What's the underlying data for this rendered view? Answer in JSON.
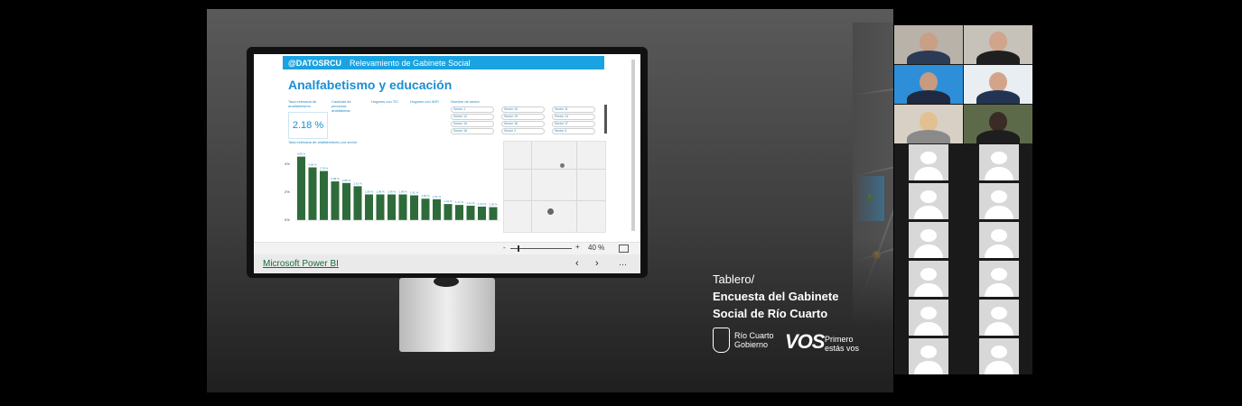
{
  "report": {
    "brand": "@DATOSRCU",
    "header_subtitle": "Relevamiento de Gabinete Social",
    "title": "Analfabetismo y educación",
    "kpi_labels": {
      "tasa": "Tasa estimada de analfabetismo",
      "cantidad": "Cantidad de personas analfabetas",
      "tic": "Hogares con TIC",
      "wifi": "Hogares con WiFi",
      "sector": "Nombre de sector"
    },
    "kpi_value": "2.18 %",
    "chart_label": "Tasa estimada de analfabetismo por sector",
    "sector_chips": [
      "Sector 1",
      "Sector 10",
      "Sector 11",
      "Sector 12",
      "Sector 13",
      "Sector 14",
      "Sector 15",
      "Sector 16",
      "Sector 17",
      "Sector 18",
      "Sector 2",
      "Sector 3"
    ]
  },
  "chart_data": {
    "type": "bar",
    "title": "Tasa estimada de analfabetismo por sector",
    "y_ticks": [
      "4%",
      "2%",
      "0%"
    ],
    "ylim": [
      0,
      5
    ],
    "values": [
      4.89,
      4.06,
      3.78,
      2.98,
      2.86,
      2.61,
      1.98,
      1.98,
      1.98,
      1.98,
      1.91,
      1.65,
      1.61,
      1.24,
      1.17,
      1.11,
      1.04,
      1.0
    ],
    "labels": [
      "4,89 %",
      "4,06 %",
      "3,78 %",
      "2,98 %",
      "2,86 %",
      "2,61 %",
      "1,98 %",
      "1,98 %",
      "1,98 %",
      "1,98 %",
      "1,91 %",
      "1,65 %",
      "1,61 %",
      "1,24 %",
      "1,17 %",
      "1,11 %",
      "1,04 %",
      "1,00 %"
    ],
    "color": "#2e6b3a"
  },
  "zoom": {
    "minus": "-",
    "plus": "+",
    "level": "40 %"
  },
  "footer": {
    "link": "Microsoft Power BI",
    "prev": "‹",
    "next": "›",
    "more": "···"
  },
  "slide": {
    "line1": "Tablero/",
    "line2": "Encuesta del Gabinete",
    "line3": "Social de Río Cuarto",
    "rc_line1": "Río Cuarto",
    "rc_line2": "Gobierno",
    "vos": "VOS",
    "vos_line1": "Primero",
    "vos_line2": "estás vos"
  },
  "colors": {
    "accent": "#1aa3e0",
    "bar": "#2e6b3a",
    "zone": "#2f9fe8"
  }
}
